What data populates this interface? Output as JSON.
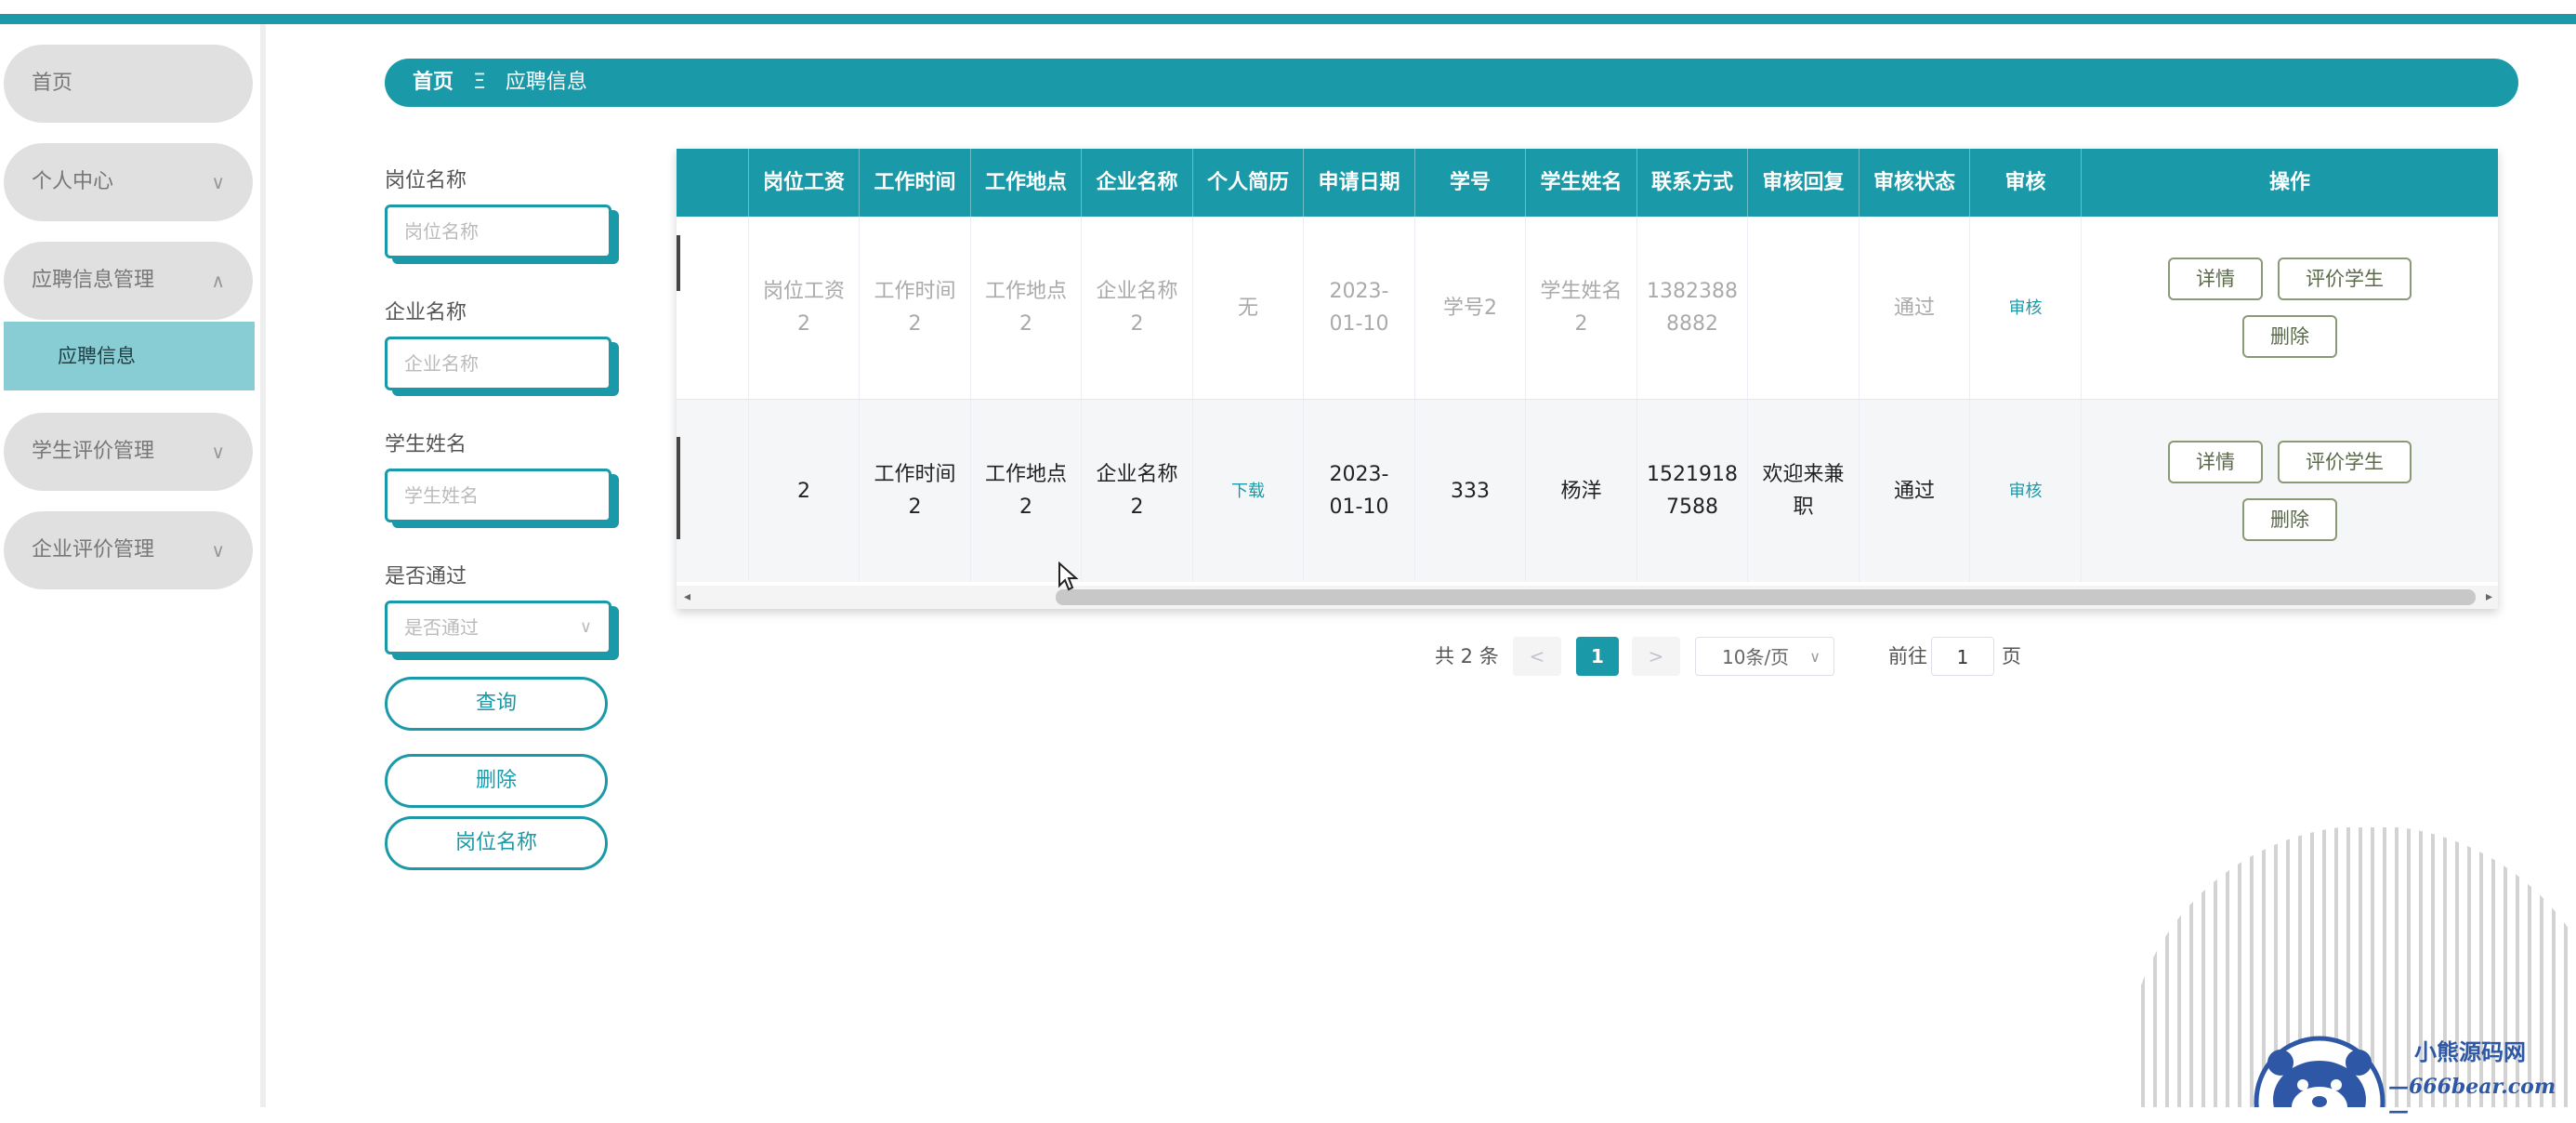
{
  "sidebar": {
    "items": [
      {
        "label": "首页"
      },
      {
        "label": "个人中心",
        "chevron": "∨"
      },
      {
        "label": "应聘信息管理",
        "chevron": "∧"
      },
      {
        "label": "学生评价管理",
        "chevron": "∨"
      },
      {
        "label": "企业评价管理",
        "chevron": "∨"
      }
    ],
    "sub_item": "应聘信息"
  },
  "breadcrumb": {
    "home": "首页",
    "separator": "Ξ",
    "current": "应聘信息"
  },
  "search": {
    "position_label": "岗位名称",
    "position_placeholder": "岗位名称",
    "company_label": "企业名称",
    "company_placeholder": "企业名称",
    "student_label": "学生姓名",
    "student_placeholder": "学生姓名",
    "pass_label": "是否通过",
    "pass_placeholder": "是否通过",
    "query_button": "查询",
    "delete_button": "删除",
    "position_button": "岗位名称"
  },
  "table": {
    "columns": [
      "岗位工资",
      "工作时间",
      "工作地点",
      "企业名称",
      "个人简历",
      "申请日期",
      "学号",
      "学生姓名",
      "联系方式",
      "审核回复",
      "审核状态",
      "审核",
      "操作"
    ],
    "rows": [
      {
        "salary": "岗位工资2",
        "work_time": "工作时间2",
        "location": "工作地点2",
        "company": "企业名称2",
        "resume": "无",
        "apply_date": "2023-01-10",
        "student_id": "学号2",
        "student_name": "学生姓名2",
        "contact": "13823888882",
        "reply": "",
        "status": "通过",
        "review": "审核"
      },
      {
        "salary": "2",
        "work_time": "工作时间2",
        "location": "工作地点2",
        "company": "企业名称2",
        "resume": "下载",
        "apply_date": "2023-01-10",
        "student_id": "333",
        "student_name": "杨洋",
        "contact": "15219187588",
        "reply": "欢迎来兼职",
        "status": "通过",
        "review": "审核"
      }
    ],
    "actions": {
      "detail": "详情",
      "evaluate": "评价学生",
      "delete": "删除"
    }
  },
  "pagination": {
    "total": "共 2 条",
    "prev": "<",
    "current_page": "1",
    "next": ">",
    "page_size": "10条/页",
    "goto_label": "前往",
    "goto_value": "1",
    "page_suffix": "页"
  },
  "watermark": {
    "name": "小熊源码网",
    "url": "—666bear.com—"
  },
  "colors": {
    "primary": "#1a9aa8",
    "submenu_active": "#89cdd4",
    "menu_bg": "#e0e0e0",
    "brand": "#2e57a6"
  }
}
